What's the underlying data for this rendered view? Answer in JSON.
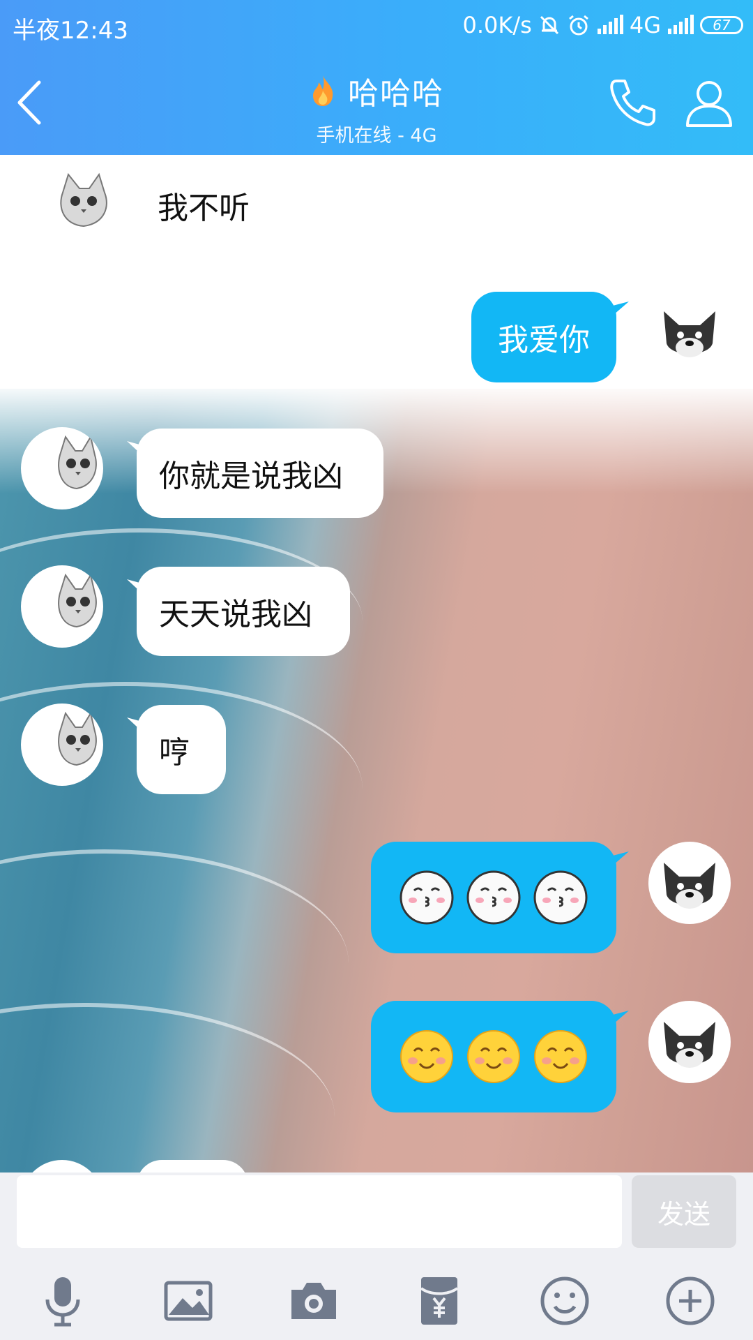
{
  "status_bar": {
    "time": "半夜12:43",
    "network_speed": "0.0K/s",
    "network_type": "4G",
    "battery": "67"
  },
  "header": {
    "title": "哈哈哈",
    "subtitle": "手机在线 - 4G",
    "accent_color": "#3aaefa"
  },
  "messages": [
    {
      "from": "them",
      "text": "我不听"
    },
    {
      "from": "me",
      "text": "我爱你"
    },
    {
      "from": "them",
      "text": "你就是说我凶"
    },
    {
      "from": "them",
      "text": "天天说我凶"
    },
    {
      "from": "them",
      "text": "哼"
    },
    {
      "from": "me",
      "emoji": [
        "kiss-emoji",
        "kiss-emoji",
        "kiss-emoji"
      ]
    },
    {
      "from": "me",
      "emoji": [
        "smile-emoji",
        "smile-emoji",
        "smile-emoji"
      ]
    }
  ],
  "input": {
    "value": "",
    "send_label": "发送"
  },
  "toolbar": [
    "microphone-icon",
    "image-icon",
    "camera-icon",
    "red-packet-icon",
    "emoji-icon",
    "plus-icon"
  ],
  "colors": {
    "bubble_out": "#12b7f5",
    "bubble_in": "#ffffff",
    "input_bg": "#eff0f4"
  }
}
